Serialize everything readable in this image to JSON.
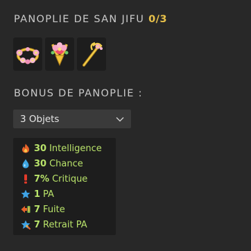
{
  "set": {
    "title": "PANOPLIE DE SAN JIFU",
    "count": "0/3",
    "items": [
      {
        "icon": "flower-crown-icon"
      },
      {
        "icon": "flower-amulet-icon"
      },
      {
        "icon": "golden-staff-icon"
      }
    ]
  },
  "bonus": {
    "title": "BONUS DE PANOPLIE :",
    "selected": "3 Objets",
    "stats": [
      {
        "value": "30",
        "label": "Intelligence",
        "icon": "fire-icon",
        "color": "#e8632a"
      },
      {
        "value": "30",
        "label": "Chance",
        "icon": "water-drop-icon",
        "color": "#3fa7e3"
      },
      {
        "value": "7%",
        "label": "Critique",
        "icon": "exclamation-icon",
        "color": "#e23a2a"
      },
      {
        "value": "1",
        "label": "PA",
        "icon": "star-icon",
        "color": "#3ea3e6"
      },
      {
        "value": "7",
        "label": "Fuite",
        "icon": "flee-icon",
        "color": "#e8b04a"
      },
      {
        "value": "7",
        "label": "Retrait PA",
        "icon": "star-remove-icon",
        "color": "#3ea3e6"
      }
    ]
  },
  "colors": {
    "accent": "#e8c14a",
    "bonus_text": "#b9e36a",
    "background": "#282828"
  }
}
